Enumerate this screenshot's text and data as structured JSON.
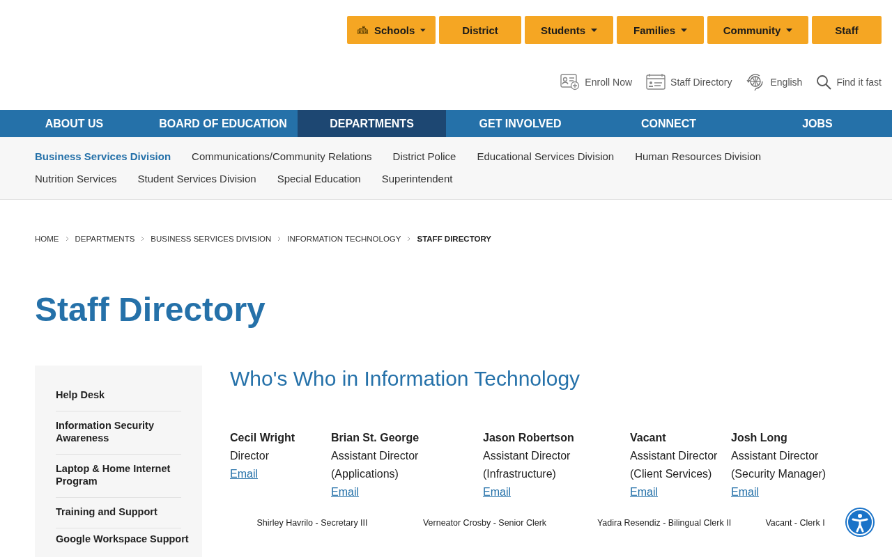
{
  "top_buttons": [
    {
      "label": "Schools",
      "icon": true,
      "dropdown": true
    },
    {
      "label": "District",
      "icon": false,
      "dropdown": false
    },
    {
      "label": "Students",
      "icon": false,
      "dropdown": true
    },
    {
      "label": "Families",
      "icon": false,
      "dropdown": true
    },
    {
      "label": "Community",
      "icon": false,
      "dropdown": true
    },
    {
      "label": "Staff",
      "icon": false,
      "dropdown": false
    }
  ],
  "utility_links": [
    {
      "kind": "enroll",
      "label": "Enroll Now"
    },
    {
      "kind": "directory",
      "label": "Staff Directory"
    },
    {
      "kind": "language",
      "label": "English"
    },
    {
      "kind": "search",
      "label": "Find it fast"
    }
  ],
  "main_nav": [
    {
      "label": "ABOUT US",
      "selected": false
    },
    {
      "label": "BOARD OF EDUCATION",
      "selected": false
    },
    {
      "label": "DEPARTMENTS",
      "selected": true
    },
    {
      "label": "GET INVOLVED",
      "selected": false
    },
    {
      "label": "CONNECT",
      "selected": false
    },
    {
      "label": "JOBS",
      "selected": false
    }
  ],
  "sub_nav": [
    {
      "label": "Business Services Division",
      "selected": true
    },
    {
      "label": "Communications/Community Relations",
      "selected": false
    },
    {
      "label": "District Police",
      "selected": false
    },
    {
      "label": "Educational Services Division",
      "selected": false
    },
    {
      "label": "Human Resources Division",
      "selected": false
    },
    {
      "label": "Nutrition Services",
      "selected": false
    },
    {
      "label": "Student Services Division",
      "selected": false
    },
    {
      "label": "Special Education",
      "selected": false
    },
    {
      "label": "Superintendent",
      "selected": false
    }
  ],
  "breadcrumb": [
    "HOME",
    "DEPARTMENTS",
    "BUSINESS SERVICES DIVISION",
    "INFORMATION TECHNOLOGY",
    "STAFF DIRECTORY"
  ],
  "page_title": "Staff Directory",
  "sidebar": {
    "items": [
      "Help Desk",
      "Information Security Awareness",
      "Laptop & Home Internet Program",
      "Training and Support",
      "Google Workspace Support"
    ]
  },
  "section_title": "Who's Who in Information Technology",
  "staff": [
    {
      "name": "Cecil Wright",
      "title_lines": [
        "Director"
      ],
      "link": "Email"
    },
    {
      "name": "Brian St. George",
      "title_lines": [
        "Assistant Director",
        "(Applications)"
      ],
      "link": "Email"
    },
    {
      "name": "Jason Robertson",
      "title_lines": [
        "Assistant Director",
        "(Infrastructure)"
      ],
      "link": "Email"
    },
    {
      "name": "Vacant",
      "title_lines": [
        "Assistant Director",
        "(Client Services)"
      ],
      "link": "Email"
    },
    {
      "name": "Josh Long",
      "title_lines": [
        "Assistant Director",
        "(Security Manager)"
      ],
      "link": "Email"
    }
  ],
  "support_staff": [
    "Shirley Havrilo - Secretary III",
    "Verneator Crosby - Senior Clerk",
    "Yadira Resendiz - Bilingual Clerk II",
    "Vacant - Clerk I"
  ]
}
